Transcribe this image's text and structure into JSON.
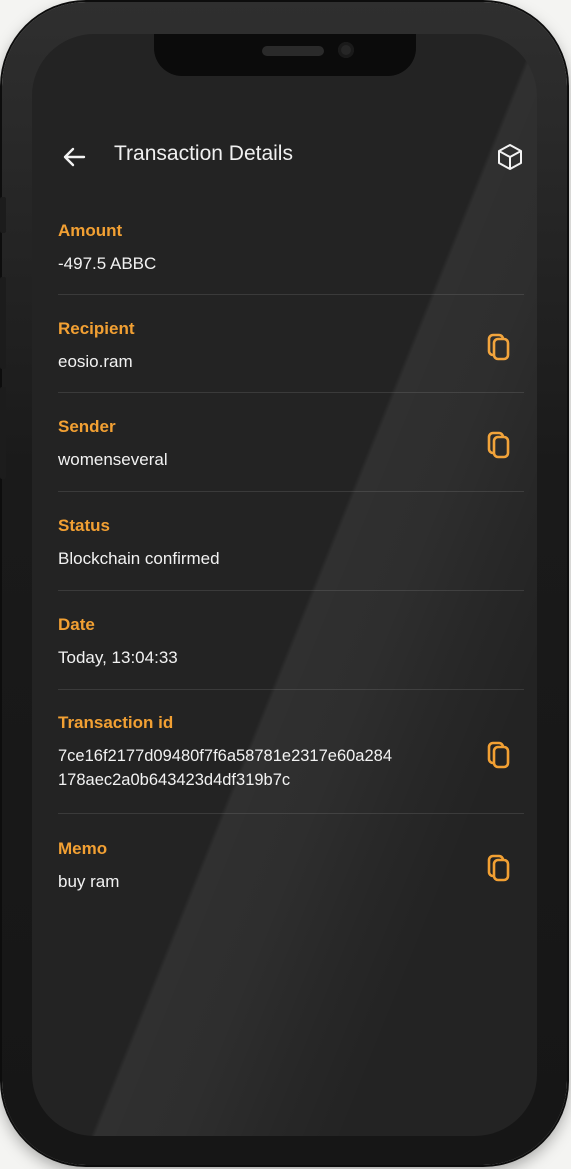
{
  "header": {
    "title": "Transaction Details",
    "back_icon": "arrow-left-icon",
    "action_icon": "cube-icon"
  },
  "fields": [
    {
      "label": "Amount",
      "value": "-497.5 ABBC",
      "copyable": false
    },
    {
      "label": "Recipient",
      "value": "eosio.ram",
      "copyable": true
    },
    {
      "label": "Sender",
      "value": "womenseveral",
      "copyable": true
    },
    {
      "label": "Status",
      "value": "Blockchain confirmed",
      "copyable": false
    },
    {
      "label": "Date",
      "value": "Today, 13:04:33",
      "copyable": false
    },
    {
      "label": "Transaction id",
      "value_line1": "7ce16f2177d09480f7f6a58781e2317e60a284",
      "value_line2": "178aec2a0b643423d4df319b7c",
      "copyable": true
    },
    {
      "label": "Memo",
      "value": "buy ram",
      "copyable": true
    }
  ],
  "colors": {
    "accent": "#f2a033",
    "background": "#232323",
    "text": "#f2f2f2",
    "divider": "#3a3a3a"
  }
}
